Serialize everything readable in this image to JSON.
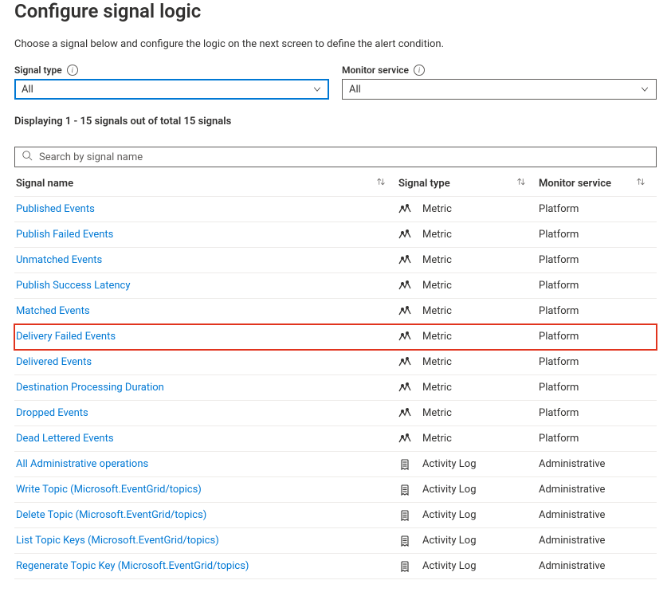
{
  "header": {
    "title": "Configure signal logic"
  },
  "description": "Choose a signal below and configure the logic on the next screen to define the alert condition.",
  "filters": {
    "signal_type": {
      "label": "Signal type",
      "value": "All"
    },
    "monitor_service": {
      "label": "Monitor service",
      "value": "All"
    }
  },
  "count_line": "Displaying 1 - 15 signals out of total 15 signals",
  "search": {
    "placeholder": "Search by signal name"
  },
  "columns": {
    "name": "Signal name",
    "type": "Signal type",
    "service": "Monitor service"
  },
  "type_labels": {
    "metric": "Metric",
    "activity": "Activity Log"
  },
  "service_labels": {
    "platform": "Platform",
    "administrative": "Administrative"
  },
  "signals": [
    {
      "name": "Published Events",
      "type": "metric",
      "service": "platform",
      "highlight": false
    },
    {
      "name": "Publish Failed Events",
      "type": "metric",
      "service": "platform",
      "highlight": false
    },
    {
      "name": "Unmatched Events",
      "type": "metric",
      "service": "platform",
      "highlight": false
    },
    {
      "name": "Publish Success Latency",
      "type": "metric",
      "service": "platform",
      "highlight": false
    },
    {
      "name": "Matched Events",
      "type": "metric",
      "service": "platform",
      "highlight": false
    },
    {
      "name": "Delivery Failed Events",
      "type": "metric",
      "service": "platform",
      "highlight": true
    },
    {
      "name": "Delivered Events",
      "type": "metric",
      "service": "platform",
      "highlight": false
    },
    {
      "name": "Destination Processing Duration",
      "type": "metric",
      "service": "platform",
      "highlight": false
    },
    {
      "name": "Dropped Events",
      "type": "metric",
      "service": "platform",
      "highlight": false
    },
    {
      "name": "Dead Lettered Events",
      "type": "metric",
      "service": "platform",
      "highlight": false
    },
    {
      "name": "All Administrative operations",
      "type": "activity",
      "service": "administrative",
      "highlight": false
    },
    {
      "name": "Write Topic (Microsoft.EventGrid/topics)",
      "type": "activity",
      "service": "administrative",
      "highlight": false
    },
    {
      "name": "Delete Topic (Microsoft.EventGrid/topics)",
      "type": "activity",
      "service": "administrative",
      "highlight": false
    },
    {
      "name": "List Topic Keys (Microsoft.EventGrid/topics)",
      "type": "activity",
      "service": "administrative",
      "highlight": false
    },
    {
      "name": "Regenerate Topic Key (Microsoft.EventGrid/topics)",
      "type": "activity",
      "service": "administrative",
      "highlight": false
    }
  ]
}
